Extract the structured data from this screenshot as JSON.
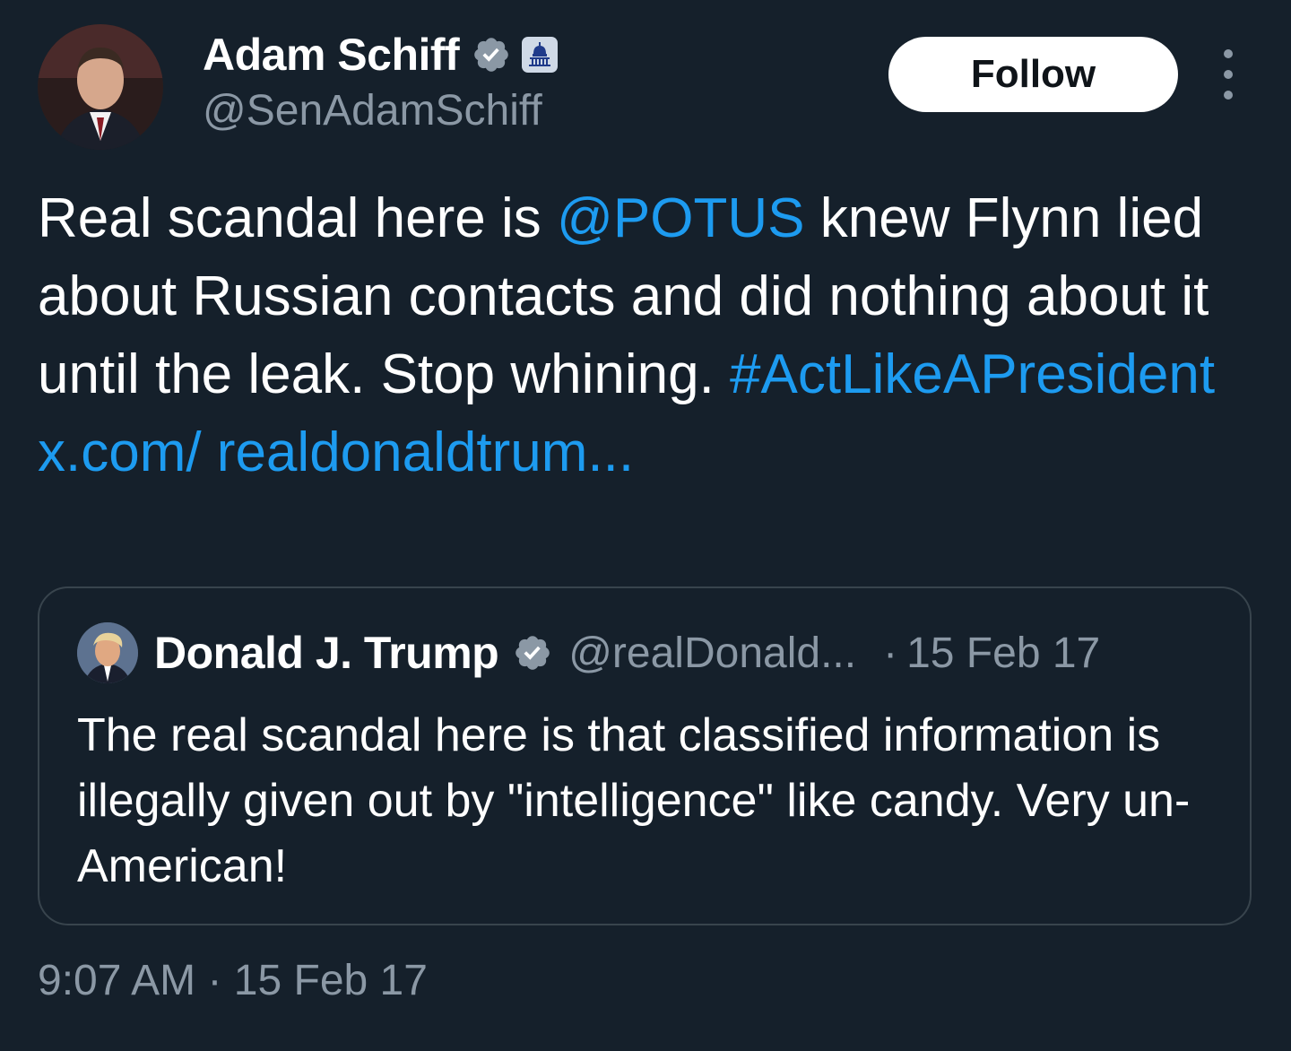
{
  "author": {
    "name": "Adam Schiff",
    "handle": "@SenAdamSchiff",
    "verified_icon": "verified-badge-icon",
    "affiliation_icon": "capitol-building-icon"
  },
  "follow_button": {
    "label": "Follow"
  },
  "more_button": {
    "icon": "more-vertical-icon"
  },
  "tweet": {
    "segments": [
      {
        "text": "Real scandal here is ",
        "type": "text"
      },
      {
        "text": "@POTUS",
        "type": "mention"
      },
      {
        "text": " knew Flynn lied about Russian contacts and did nothing about it until the leak. Stop whining. ",
        "type": "text"
      },
      {
        "text": "#ActLikeAPresident",
        "type": "hashtag"
      },
      {
        "text": " ",
        "type": "text"
      },
      {
        "text": "x.com/ realdonaldtrum...",
        "type": "url"
      }
    ]
  },
  "quoted_tweet": {
    "name": "Donald J. Trump",
    "handle": "@realDonald...",
    "separator": "·",
    "date": "15 Feb 17",
    "text": "The real scandal here is that classified information is illegally given out by \"intelligence\" like candy. Very un-American!"
  },
  "timestamp": "9:07 AM · 15 Feb 17",
  "colors": {
    "background": "#15202b",
    "link": "#1d9bf0",
    "secondary_text": "#8b98a5",
    "verified": "#8b98a5",
    "border": "#38444d"
  }
}
